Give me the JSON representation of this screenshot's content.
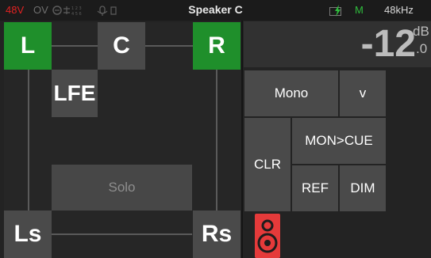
{
  "status": {
    "phantom": "48V",
    "overload": "OV",
    "title": "Speaker C",
    "mode": "M",
    "sample_rate": "48kHz"
  },
  "colors": {
    "active": "#1f8f2b",
    "phantom": "#e32222",
    "mode": "#2fbd3d",
    "speaker": "#e53a3a"
  },
  "speakers": {
    "L": "L",
    "C": "C",
    "R": "R",
    "LFE": "LFE",
    "Ls": "Ls",
    "Rs": "Rs",
    "active": [
      "L",
      "R"
    ]
  },
  "solo_label": "Solo",
  "level": {
    "value": "-12",
    "unit": "dB",
    "fraction": ".0"
  },
  "buttons": {
    "mono": "Mono",
    "mono_arrow": "v",
    "clr": "CLR",
    "mon_cue": "MON>CUE",
    "ref": "REF",
    "dim": "DIM"
  },
  "icons": {
    "status_icons": "status-icons",
    "battery": "battery-charging-icon",
    "speaker": "speaker-icon"
  }
}
